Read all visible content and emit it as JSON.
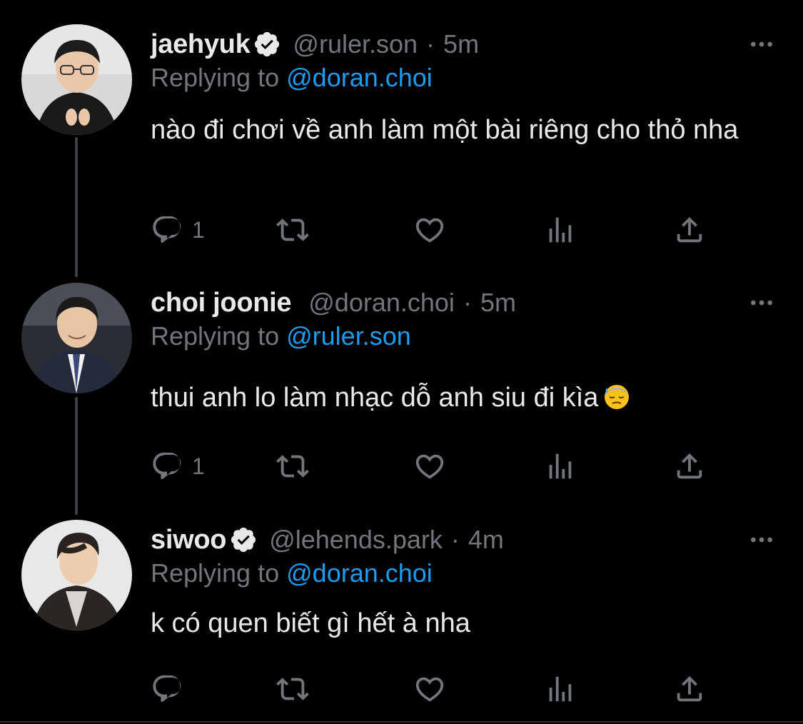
{
  "colors": {
    "background": "#000000",
    "text_primary": "#e7e9ea",
    "text_secondary": "#71767b",
    "mention_blue": "#1d9bf0",
    "thread_line": "#3e4144"
  },
  "tweets": [
    {
      "display_name": "jaehyuk",
      "verified": true,
      "handle": "@ruler.son",
      "separator": "·",
      "time": "5m",
      "replying_prefix": "Replying to",
      "replying_to": "@doran.choi",
      "text": "nào đi chơi về anh làm một bài riêng cho thỏ nha",
      "reply_count": "1",
      "icons": [
        "reply-icon",
        "retweet-icon",
        "like-icon",
        "views-icon",
        "share-icon",
        "more-icon"
      ]
    },
    {
      "display_name": "choi joonie",
      "verified": false,
      "handle": "@doran.choi",
      "separator": "·",
      "time": "5m",
      "replying_prefix": "Replying to",
      "replying_to": "@ruler.son",
      "text": "thui anh lo làm nhạc dỗ anh siu đi kìa",
      "emoji": "downcast-face-with-sweat-icon",
      "reply_count": "1",
      "icons": [
        "reply-icon",
        "retweet-icon",
        "like-icon",
        "views-icon",
        "share-icon",
        "more-icon"
      ]
    },
    {
      "display_name": "siwoo",
      "verified": true,
      "handle": "@lehends.park",
      "separator": "·",
      "time": "4m",
      "replying_prefix": "Replying to",
      "replying_to": "@doran.choi",
      "text": "k có quen biết gì hết à nha",
      "reply_count": "",
      "icons": [
        "reply-icon",
        "retweet-icon",
        "like-icon",
        "views-icon",
        "share-icon",
        "more-icon"
      ]
    }
  ]
}
